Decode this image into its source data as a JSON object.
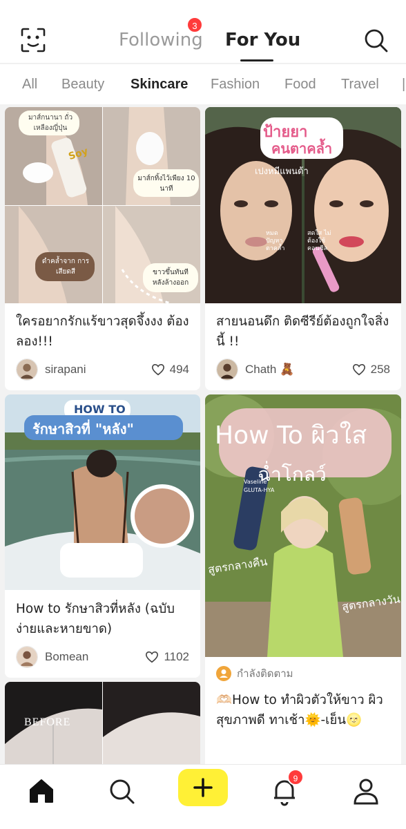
{
  "header": {
    "tabs": [
      {
        "label": "Following",
        "badge": "3",
        "active": false
      },
      {
        "label": "For You",
        "active": true
      }
    ]
  },
  "categories": [
    "All",
    "Beauty",
    "Skincare",
    "Fashion",
    "Food",
    "Travel"
  ],
  "active_category": "Skincare",
  "posts": [
    {
      "title": "ใครอยากรักแร้ขาวสุดจึ้งงง ต้องลอง!!!",
      "author": "sirapani",
      "likes": "494",
      "image_text": [
        "มาส์กนานา ถั่วเหลืองญี่ปุ่น",
        "Soy",
        "มาส์กทิ้งไว้เพียง 10 นาที",
        "ดำคล้ำจาก การเสียดสี",
        "ขาวขึ้นทันที หลังล้างออก"
      ]
    },
    {
      "title": "สายนอนดึก ติดซีรีย์ต้องถูกใจสิ่งนี้ !!",
      "author": "Chath 🧸",
      "likes": "258",
      "image_text": [
        "ป้ายยา",
        "คนตาคล้ำ",
        "เปงหมีแพนด้า",
        "หมดปัญหา ตาคล้ำ",
        "สดใส ไม่ต้องใช้ คอนซีล"
      ]
    },
    {
      "title": "How to รักษาสิวที่หลัง (ฉบับง่ายและหายขาด)",
      "author": "Bomean",
      "likes": "1102",
      "image_text": [
        "HOW TO",
        "รักษาสิวที่ \"หลัง\""
      ]
    },
    {
      "status": "กำลังติดตาม",
      "title": "🫶🏻How to ทำผิวตัวให้ขาว ผิวสุขภาพดี ทาเช้า🌞-เย็น🌝",
      "image_text": [
        "How To ผิวใส",
        "ฉ่ำโกลว์",
        "Vaseline",
        "GLUTA-HYA",
        "สูตรกลางคืน",
        "สูตรกลางวัน"
      ]
    },
    {
      "image_text": [
        "BEFORE"
      ]
    }
  ],
  "bottom_nav": {
    "items": [
      "home",
      "search",
      "add",
      "notifications",
      "profile"
    ],
    "notification_badge": "9"
  },
  "colors": {
    "accent": "#fff036",
    "badge": "#ff3b3b"
  }
}
